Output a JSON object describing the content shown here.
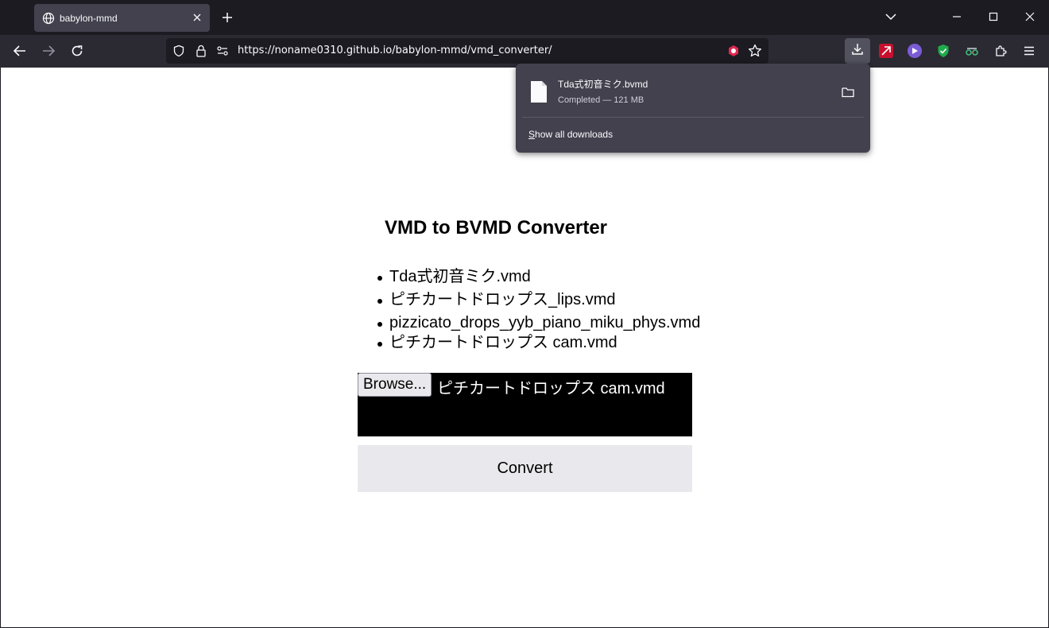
{
  "browser": {
    "tab": {
      "title": "babylon-mmd"
    },
    "url": "https://noname0310.github.io/babylon-mmd/vmd_converter/",
    "colors": {
      "frame": "#1c1b22",
      "toolbar": "#2b2a33",
      "tab_active": "#42414d"
    }
  },
  "page": {
    "title": "VMD to BVMD Converter",
    "files": [
      "Tda式初音ミク.vmd",
      "ピチカートドロップス_lips.vmd",
      "pizzicato_drops_yyb_piano_miku_phys.vmd",
      "ピチカートドロップス cam.vmd"
    ],
    "file_input": {
      "button_label": "Browse...",
      "selected_name": "ピチカートドロップス cam.vmd"
    },
    "convert_label": "Convert"
  },
  "downloads": {
    "item": {
      "filename": "Tda式初音ミク.bvmd",
      "status": "Completed — 121 MB"
    },
    "show_all_prefix": "S",
    "show_all_rest": "how all downloads"
  }
}
